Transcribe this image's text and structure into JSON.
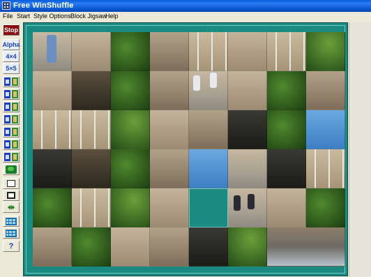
{
  "window": {
    "title": "Free WinShuffle"
  },
  "menu": [
    "File",
    "Start",
    "Style Options",
    "Block Jigsaw",
    "Help"
  ],
  "toolbar": {
    "stop_label": "Stop",
    "alpha_label": "Alpha",
    "grid4_label": "4×4",
    "grid5_label": "5×5",
    "help_label": "?",
    "icons": [
      "picture-set-1-icon",
      "picture-set-2-icon",
      "picture-set-3-icon",
      "picture-set-4-icon",
      "picture-set-5-icon",
      "picture-set-6-icon",
      "picture-set-7-icon",
      "world-map-icon",
      "frame-outline-icon",
      "frame-thick-icon",
      "shuffle-arrows-icon",
      "grid-small-icon",
      "grid-large-icon"
    ]
  },
  "colors": {
    "board": "#1b8a80",
    "title_bar": "#0a5ddb",
    "stop_button": "#8b0f0f"
  },
  "puzzle": {
    "columns": 8,
    "rows": 6,
    "empty_tile": {
      "row": 4,
      "col": 4
    }
  }
}
